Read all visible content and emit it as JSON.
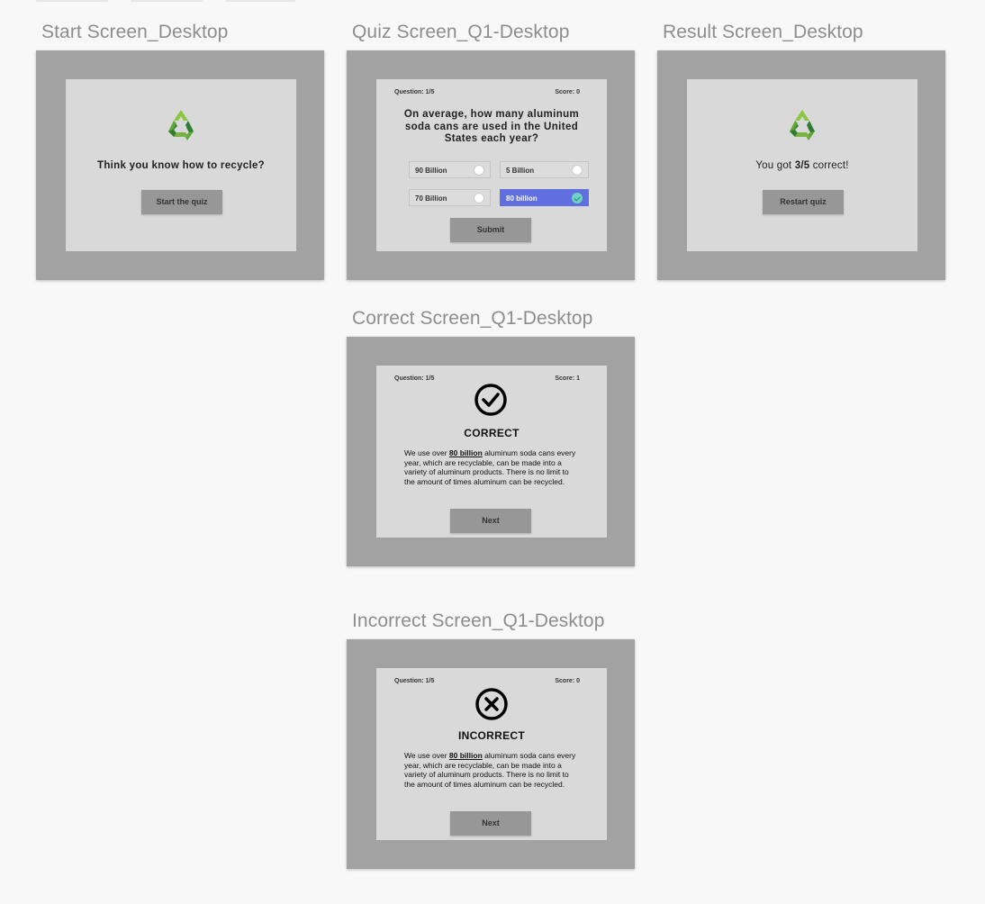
{
  "titles": {
    "start": "Start Screen_Desktop",
    "quiz": "Quiz Screen_Q1-Desktop",
    "result": "Result Screen_Desktop",
    "correct": "Correct Screen_Q1-Desktop",
    "incorrect": "Incorrect Screen_Q1-Desktop"
  },
  "start": {
    "heading": "Think you know how to recycle?",
    "button": "Start the quiz"
  },
  "quiz": {
    "question_counter": "Question: 1/5",
    "score": "Score: 0",
    "question": "On average, how many aluminum soda cans are used in the United States each year?",
    "options": [
      {
        "label": "90 Billion",
        "selected": false
      },
      {
        "label": "5 Billion",
        "selected": false
      },
      {
        "label": "70 Billion",
        "selected": false
      },
      {
        "label": "80 billion",
        "selected": true
      }
    ],
    "submit": "Submit"
  },
  "result": {
    "text_before": "You got ",
    "score": "3/5",
    "text_after": " correct!",
    "button": "Restart quiz"
  },
  "correct": {
    "question_counter": "Question: 1/5",
    "score": "Score: 1",
    "title": "CORRECT",
    "explain_before": "We use over ",
    "explain_highlight": "80 billion",
    "explain_after": " aluminum soda cans every year, which are recyclable, can be made into a variety of aluminum products. There is no limit to the amount of times aluminum can be recycled.",
    "button": "Next"
  },
  "incorrect": {
    "question_counter": "Question: 1/5",
    "score": "Score: 0",
    "title": "INCORRECT",
    "explain_before": "We use over ",
    "explain_highlight": "80 billion",
    "explain_after": " aluminum soda cans every year, which are recyclable, can be made into a variety of aluminum products. There is no limit to the amount of times aluminum can be recycled.",
    "button": "Next"
  },
  "colors": {
    "frame": "#a2a2a2",
    "card": "#d9d9d9",
    "button": "#979797",
    "selected_option": "#5f6fe0",
    "selected_radio": "#6fd3c4",
    "recycle_green_light": "#8cc63f",
    "recycle_green_dark": "#2e7d32"
  },
  "icons": {
    "recycle": "recycle-icon",
    "correct": "check-circle-icon",
    "incorrect": "x-circle-icon"
  }
}
